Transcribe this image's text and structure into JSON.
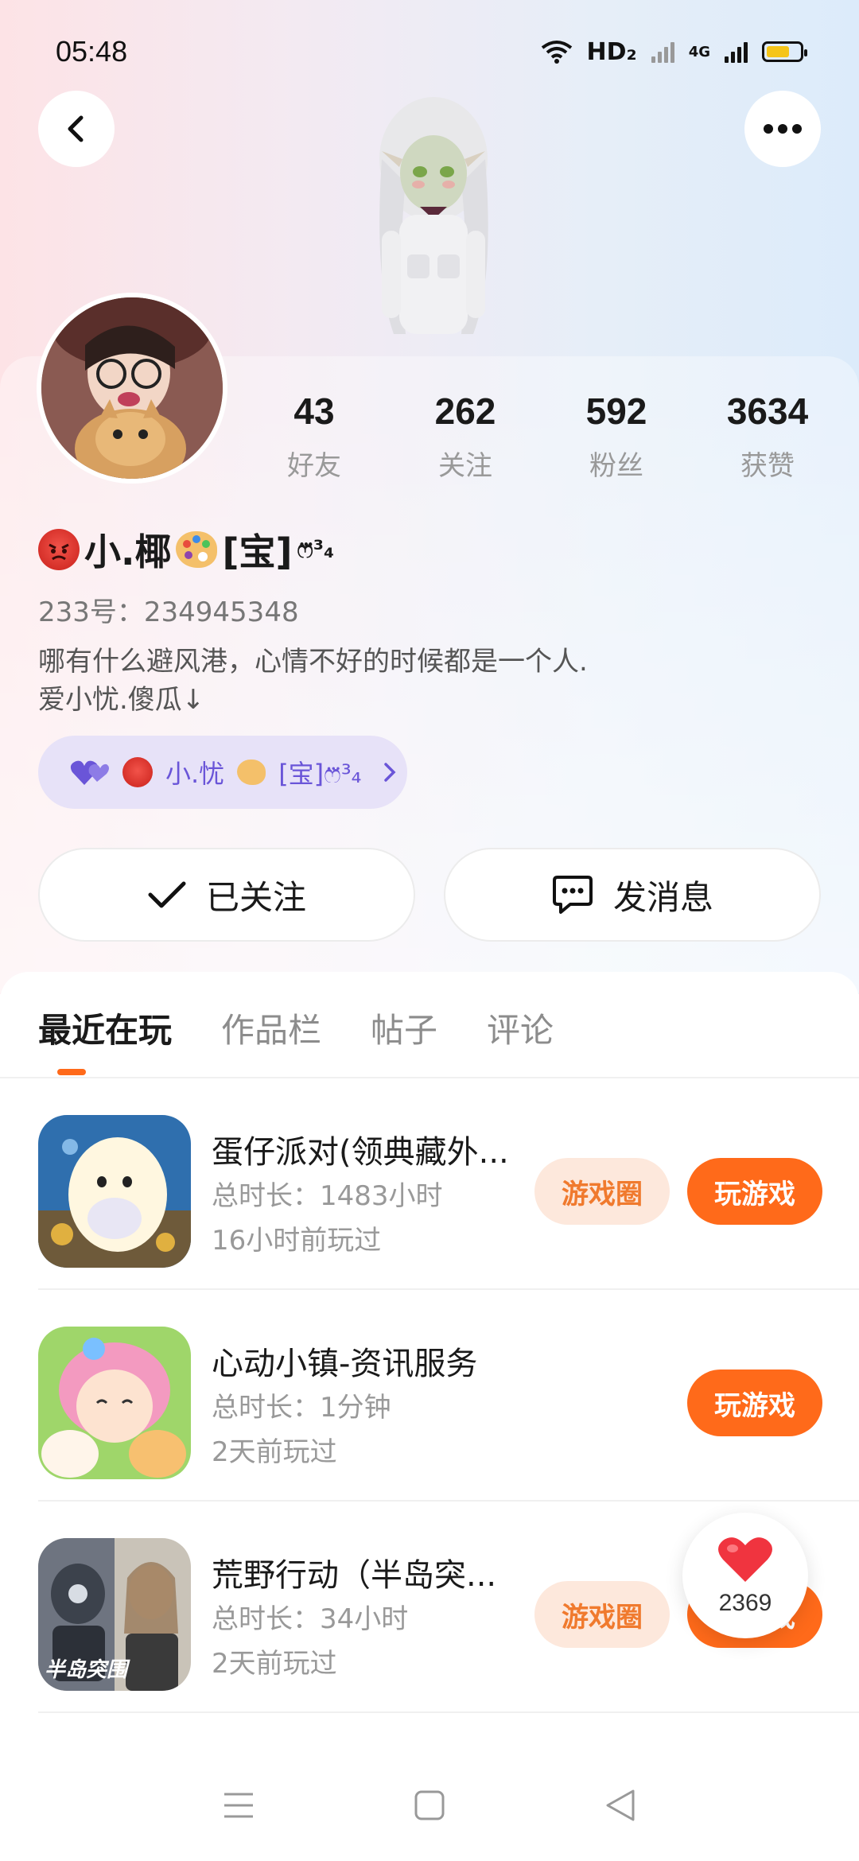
{
  "status_bar": {
    "time": "05:48",
    "network_label": "HD₂",
    "network_type": "4G"
  },
  "profile": {
    "nickname_text": "小.椰",
    "nickname_suffix": "[宝]",
    "nickname_deco": "ෆ⃛³₄",
    "stats": [
      {
        "num": "43",
        "label": "好友"
      },
      {
        "num": "262",
        "label": "关注"
      },
      {
        "num": "592",
        "label": "粉丝"
      },
      {
        "num": "3634",
        "label": "获赞"
      }
    ],
    "uid": "233号：234945348",
    "bio_line1": "哪有什么避风港，心情不好的时候都是一个人.",
    "bio_line2": "爱小忧.傻瓜↓",
    "cp_name": "小.忧",
    "cp_suffix": "[宝]ෆ⃛³₄"
  },
  "actions": {
    "follow_label": "已关注",
    "message_label": "发消息"
  },
  "tabs": [
    "最近在玩",
    "作品栏",
    "帖子",
    "评论"
  ],
  "games": [
    {
      "title": "蛋仔派对(领典藏外...",
      "duration": "总时长：1483小时",
      "last_played": "16小时前玩过",
      "circle_label": "游戏圈",
      "play_label": "玩游戏"
    },
    {
      "title": "心动小镇-资讯服务",
      "duration": "总时长：1分钟",
      "last_played": "2天前玩过",
      "play_label": "玩游戏"
    },
    {
      "title": "荒野行动（半岛突...",
      "duration": "总时长：34小时",
      "last_played": "2天前玩过",
      "circle_label": "游戏圈",
      "play_label": "玩游戏",
      "icon_text": "半岛突围"
    }
  ],
  "like_bubble": {
    "count": "2369"
  },
  "colors": {
    "accent": "#ff6a1a",
    "circle_bg": "#fde8dc",
    "cp_tag_bg": "#e7e2f8",
    "cp_tag_text": "#6a55d8"
  },
  "icons": [
    "back-icon",
    "more-icon",
    "wifi-icon",
    "signal-icon",
    "battery-icon",
    "check-icon",
    "chat-icon",
    "heart-icon",
    "menu-icon",
    "home-icon",
    "back-triangle-icon"
  ]
}
